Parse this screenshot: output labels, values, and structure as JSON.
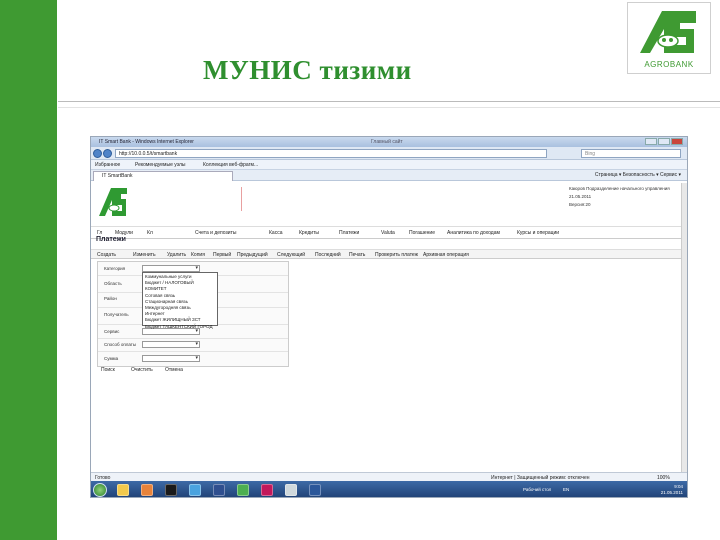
{
  "slide": {
    "title": "МУНИС тизими",
    "logo_text": "AGROBANK"
  },
  "browser": {
    "window_title": "IT Smart Bank - Windows Internet Explorer",
    "window_center": "Главный сайт",
    "address": "http://10.0.0.5/t/smartbank",
    "search_placeholder": "Bing",
    "favorites": [
      "Избранное",
      "Рекомендуемые узлы",
      "Коллекция веб-фрагм..."
    ],
    "tab_title": "IT SmartBank",
    "tab_right": "Страница ▾  Безопасность ▾  Сервис ▾"
  },
  "app": {
    "user_info": [
      "Каюров Подразделение начального управления",
      "21.05.2011",
      "Версия:20"
    ],
    "menu": [
      "Гл",
      "Модули",
      "Кл",
      "Счета и депозиты",
      "Касса",
      "Кредиты",
      "Платежи",
      "Valuta",
      "Погашение",
      "Аналитика по доходам",
      "Курсы и операции"
    ],
    "page_title": "Платежи",
    "toolbar": [
      "Создать",
      "Изменить",
      "Удалить",
      "Копия",
      "Первый",
      "Предыдущий",
      "Следующий",
      "Последний",
      "Печать",
      "Проверить платеж",
      "Архивная операция"
    ],
    "form_labels": [
      "Категория",
      "Область",
      "Район",
      "Получатель",
      "Сервис",
      "Способ оплаты",
      "Сумма"
    ],
    "dropdown_items": [
      "Коммунальные услуги",
      "Бюджет / НАЛОГОВЫЙ КОМИТЕТ",
      "Сотовая связь",
      "Стационарная связь",
      "Междугородняя связь",
      "Интернет",
      "Бюджет ЖИЛИЩНЫЙ ЗСТ",
      "Бюджет ТАШКЕНТСКИЙ ГОРОД"
    ],
    "bottom_buttons": [
      "Поиск",
      "Очистить",
      "Отмена"
    ]
  },
  "statusbar": {
    "left": "Готово",
    "center": "Интернет | Защищенный режим: отключен",
    "zoom": "100%"
  },
  "taskbar": {
    "tray_left": "Рабочий стол",
    "tray_lang": "EN",
    "time": "9:04",
    "date": "21.05.2011"
  }
}
